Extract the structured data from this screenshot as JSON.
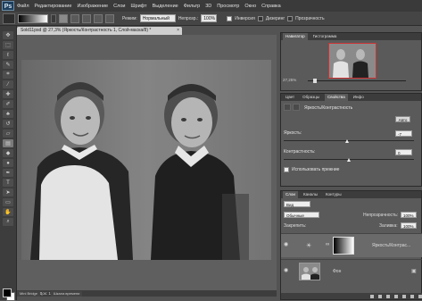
{
  "menubar": {
    "logo": "Ps",
    "items": [
      "Файл",
      "Редактирование",
      "Изображение",
      "Слои",
      "Шрифт",
      "Выделение",
      "Фильтр",
      "3D",
      "Просмотр",
      "Окно",
      "Справка"
    ]
  },
  "options": {
    "mode_label": "Режим:",
    "mode_value": "Нормальный",
    "opacity_label": "Непрозр.:",
    "opacity_value": "100%",
    "invert_label": "Инверсия",
    "invert_checked": false,
    "dither_label": "Дизеринг",
    "dither_checked": true,
    "transparency_label": "Прозрачность",
    "transparency_checked": true
  },
  "document": {
    "tab_title": "Sold11psd @ 27,3% (Яркость/Контрастность 1, Слой-маска/8) *",
    "zoom": "27,25%",
    "doc_info": "Док: 11,7М/11,7М"
  },
  "bottom_tabs": [
    "Mini Bridge",
    "Шкала времени"
  ],
  "navigator": {
    "tabs": [
      "Навигатор",
      "Гистограмма"
    ],
    "zoom": "27,25%"
  },
  "properties": {
    "tabs": [
      "Цвет",
      "Образцы",
      "Свойства",
      "Инфо"
    ],
    "active_tab": "Свойства",
    "title": "Яркость/Контрастность",
    "auto_label": "Авто",
    "brightness_label": "Яркость:",
    "brightness_value": "-7",
    "brightness": -7,
    "contrast_label": "Контрастность:",
    "contrast_value": "0",
    "contrast": 0,
    "legacy_label": "Использовать прежние"
  },
  "layers": {
    "tabs": [
      "Слои",
      "Каналы",
      "Контуры"
    ],
    "kind_label": "Вид",
    "blend_mode": "Обычные",
    "opacity_label": "Непрозрачность:",
    "opacity_value": "100%",
    "lock_label": "Закрепить:",
    "fill_label": "Заливка:",
    "fill_value": "100%",
    "items": [
      {
        "name": "Яркость/Контрас..."
      },
      {
        "name": "Фон"
      }
    ]
  },
  "icons": {
    "tools": [
      "move-icon",
      "marquee-icon",
      "lasso-icon",
      "quick-select-icon",
      "crop-icon",
      "eyedropper-icon",
      "healing-brush-icon",
      "brush-icon",
      "clone-stamp-icon",
      "history-brush-icon",
      "eraser-icon",
      "gradient-icon",
      "blur-icon",
      "dodge-icon",
      "pen-icon",
      "type-icon",
      "path-select-icon",
      "shape-icon",
      "hand-icon",
      "zoom-icon"
    ]
  }
}
